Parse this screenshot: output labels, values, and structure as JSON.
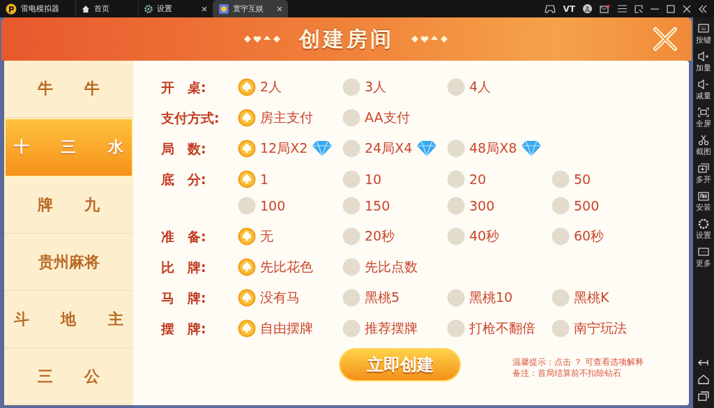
{
  "app_bar": {
    "app_name": "雷电模拟器",
    "tabs": [
      {
        "label": "首页",
        "kind": "home",
        "selected": false,
        "closable": false
      },
      {
        "label": "设置",
        "kind": "gear",
        "selected": false,
        "closable": true
      },
      {
        "label": "寰宇互娱",
        "kind": "game",
        "selected": true,
        "closable": true
      }
    ],
    "vt_label": "VT"
  },
  "dialog": {
    "title": "创建房间"
  },
  "games": [
    {
      "label": "牛 牛",
      "selected": false
    },
    {
      "label": "十 三 水",
      "selected": true
    },
    {
      "label": "牌 九",
      "selected": false
    },
    {
      "label": "贵州麻将",
      "selected": false
    },
    {
      "label": "斗 地 主",
      "selected": false
    },
    {
      "label": "三 公",
      "selected": false
    }
  ],
  "options": [
    {
      "label": "开　桌:",
      "choices": [
        {
          "text": "2人",
          "selected": true
        },
        {
          "text": "3人",
          "selected": false
        },
        {
          "text": "4人",
          "selected": false
        }
      ]
    },
    {
      "label": "支付方式:",
      "choices": [
        {
          "text": "房主支付",
          "selected": true
        },
        {
          "text": "AA支付",
          "selected": false
        }
      ]
    },
    {
      "label": "局　数:",
      "choices": [
        {
          "text": "12局X2",
          "selected": true,
          "gem": true
        },
        {
          "text": "24局X4",
          "selected": false,
          "gem": true
        },
        {
          "text": "48局X8",
          "selected": false,
          "gem": true
        }
      ]
    },
    {
      "label": "底　分:",
      "choices": [
        {
          "text": "1",
          "selected": true
        },
        {
          "text": "10",
          "selected": false
        },
        {
          "text": "20",
          "selected": false
        },
        {
          "text": "50",
          "selected": false
        },
        {
          "text": "100",
          "selected": false
        },
        {
          "text": "150",
          "selected": false
        },
        {
          "text": "300",
          "selected": false
        },
        {
          "text": "500",
          "selected": false
        }
      ]
    },
    {
      "label": "准　备:",
      "choices": [
        {
          "text": "无",
          "selected": true
        },
        {
          "text": "20秒",
          "selected": false
        },
        {
          "text": "40秒",
          "selected": false
        },
        {
          "text": "60秒",
          "selected": false
        }
      ]
    },
    {
      "label": "比　牌:",
      "choices": [
        {
          "text": "先比花色",
          "selected": true
        },
        {
          "text": "先比点数",
          "selected": false
        }
      ]
    },
    {
      "label": "马　牌:",
      "choices": [
        {
          "text": "没有马",
          "selected": true
        },
        {
          "text": "黑桃5",
          "selected": false
        },
        {
          "text": "黑桃10",
          "selected": false
        },
        {
          "text": "黑桃K",
          "selected": false
        }
      ]
    },
    {
      "label": "摆　牌:",
      "choices": [
        {
          "text": "自由摆牌",
          "selected": true
        },
        {
          "text": "推荐摆牌",
          "selected": false
        },
        {
          "text": "打枪不翻倍",
          "selected": false
        },
        {
          "text": "南宁玩法",
          "selected": false
        }
      ]
    }
  ],
  "create_button": "立即创建",
  "hints": [
    "温馨提示：点击 ？ 可查看选项解释",
    "备注：首局结算前不扣除钻石"
  ],
  "side_tools": [
    {
      "label": "按键",
      "kind": "keyboard"
    },
    {
      "label": "加量",
      "kind": "volup"
    },
    {
      "label": "减量",
      "kind": "voldown"
    },
    {
      "label": "全屏",
      "kind": "fullscreen"
    },
    {
      "label": "截图",
      "kind": "scissors"
    },
    {
      "label": "多开",
      "kind": "multi"
    },
    {
      "label": "安装",
      "kind": "apk"
    },
    {
      "label": "设置",
      "kind": "gear"
    },
    {
      "label": "更多",
      "kind": "more"
    }
  ]
}
